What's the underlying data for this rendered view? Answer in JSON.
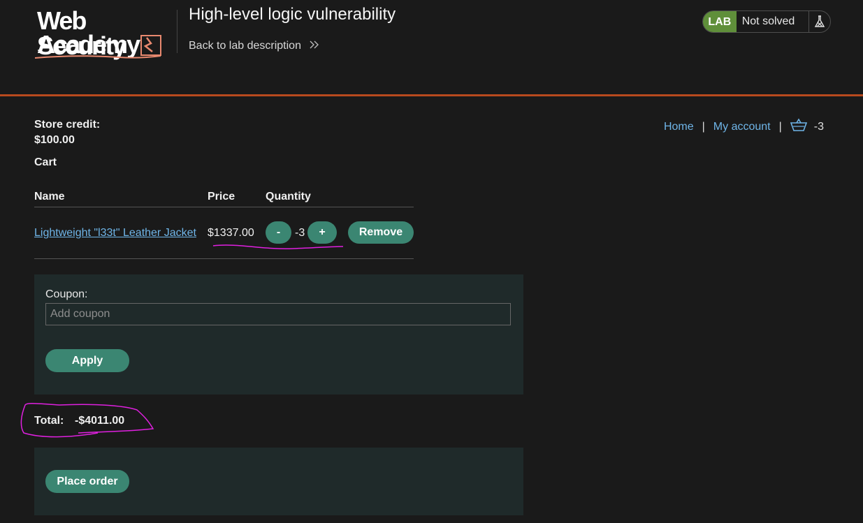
{
  "header": {
    "logo_line1": "Web Security",
    "logo_line2": "Academy",
    "lab_title": "High-level logic vulnerability",
    "back_link": "Back to lab description",
    "status": {
      "lab": "LAB",
      "state": "Not solved"
    }
  },
  "account": {
    "credit_label": "Store credit:",
    "credit_value": "$100.00"
  },
  "nav": {
    "home": "Home",
    "my_account": "My account",
    "separator": "|",
    "cart_count": "-3"
  },
  "cart": {
    "title": "Cart",
    "columns": [
      "Name",
      "Price",
      "Quantity"
    ],
    "items": [
      {
        "name": "Lightweight \"l33t\" Leather Jacket",
        "price": "$1337.00",
        "decrement_label": "-",
        "quantity": "-3",
        "increment_label": "+",
        "remove_label": "Remove"
      }
    ]
  },
  "coupon": {
    "label": "Coupon:",
    "placeholder": "Add coupon",
    "apply_label": "Apply"
  },
  "total": {
    "label": "Total:",
    "value": "-$4011.00"
  },
  "order": {
    "place_label": "Place order"
  },
  "colors": {
    "accent": "#3b8672",
    "link": "#6fb5e8",
    "header_border": "#b84a1e",
    "lab_badge": "#5f8f3a",
    "annotation": "#e020e0"
  },
  "icons": [
    "back-chevrons-icon",
    "flask-icon",
    "cart-basket-icon"
  ]
}
